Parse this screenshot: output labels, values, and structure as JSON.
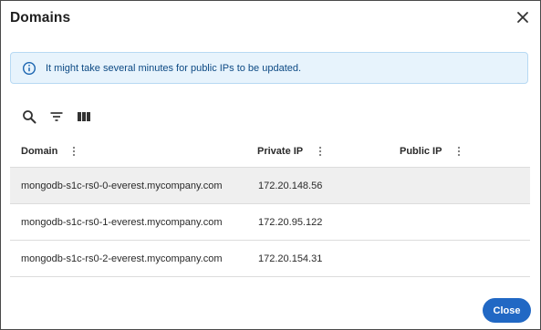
{
  "dialog": {
    "title": "Domains",
    "close_icon": "close-icon"
  },
  "alert": {
    "icon": "info-icon",
    "text": "It might take several minutes for public IPs to be updated.",
    "color": "#e7f3fc"
  },
  "toolbar": {
    "icons": [
      "search-icon",
      "filter-icon",
      "columns-icon"
    ]
  },
  "table": {
    "columns": [
      {
        "label": "Domain"
      },
      {
        "label": "Private IP"
      },
      {
        "label": "Public IP"
      }
    ],
    "rows": [
      {
        "domain": "mongodb-s1c-rs0-0-everest.mycompany.com",
        "private_ip": "172.20.148.56",
        "public_ip": ""
      },
      {
        "domain": "mongodb-s1c-rs0-1-everest.mycompany.com",
        "private_ip": "172.20.95.122",
        "public_ip": ""
      },
      {
        "domain": "mongodb-s1c-rs0-2-everest.mycompany.com",
        "private_ip": "172.20.154.31",
        "public_ip": ""
      }
    ]
  },
  "footer": {
    "close_label": "Close",
    "accent": "#2168c4"
  }
}
